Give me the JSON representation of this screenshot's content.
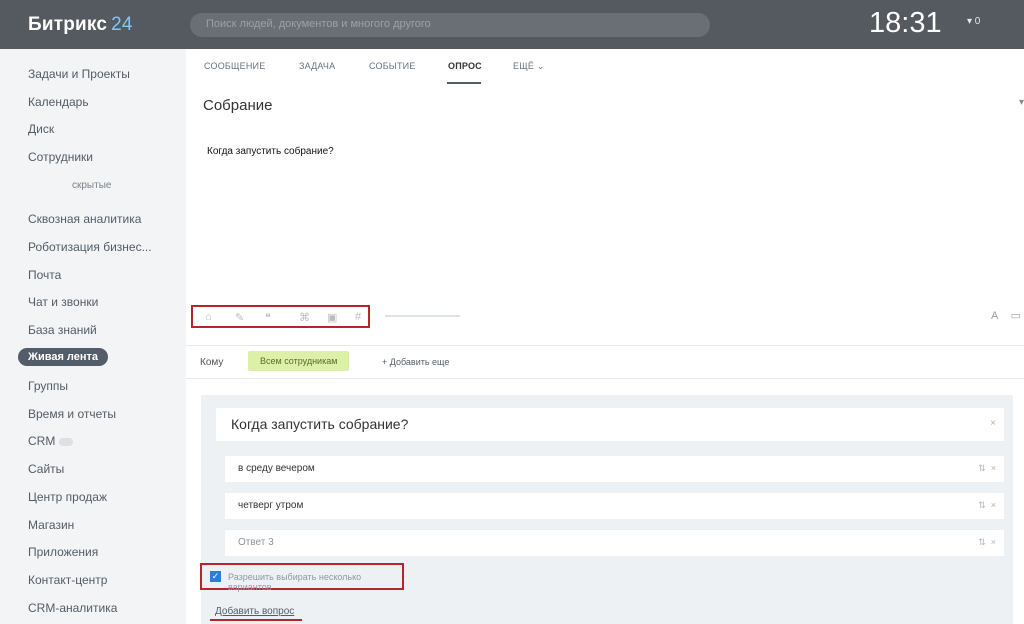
{
  "header": {
    "logo_text": "Битрикс",
    "logo_num": "24",
    "search_placeholder": "Поиск людей, документов и многого другого",
    "clock": "18:31",
    "header_control": "▾ 0"
  },
  "sidebar": {
    "items": [
      {
        "label": "Задачи и Проекты"
      },
      {
        "label": "Календарь"
      },
      {
        "label": "Диск"
      },
      {
        "label": "Сотрудники"
      }
    ],
    "sub_label": "скрытые",
    "items2": [
      {
        "label": "Сквозная аналитика"
      },
      {
        "label": "Роботизация бизнес..."
      },
      {
        "label": "Почта"
      },
      {
        "label": "Чат и звонки"
      },
      {
        "label": "База знаний"
      }
    ],
    "active_label": "Живая лента",
    "items3": [
      {
        "label": "Группы"
      },
      {
        "label": "Время и отчеты"
      },
      {
        "label": "CRM"
      },
      {
        "label": "Сайты"
      },
      {
        "label": "Центр продаж"
      },
      {
        "label": "Магазин"
      },
      {
        "label": "Приложения"
      },
      {
        "label": "Контакт-центр"
      },
      {
        "label": "CRM-аналитика"
      }
    ]
  },
  "tabs": [
    {
      "label": "Сообщение"
    },
    {
      "label": "Задача"
    },
    {
      "label": "Событие"
    },
    {
      "label": "Опрос",
      "active": true
    },
    {
      "label": "Ещё ⌄"
    }
  ],
  "post": {
    "title": "Собрание",
    "body": "Когда запустить собрание?"
  },
  "recipients": {
    "label": "Кому",
    "chip": "Всем сотрудникам",
    "add_more": "+ Добавить еще"
  },
  "poll": {
    "question": "Когда запустить собрание?",
    "answers": [
      {
        "text": "в среду вечером",
        "placeholder": false
      },
      {
        "text": "четверг утром",
        "placeholder": false
      },
      {
        "text": "Ответ  3",
        "placeholder": true
      }
    ],
    "multi_label": "Разрешить выбирать несколько вариантов",
    "add_question": "Добавить вопрос"
  },
  "colors": {
    "header_bg": "#555a61",
    "accent_blue": "#7fc8f1",
    "highlight_red": "#b5262b",
    "chip_green": "#ddf0a8"
  }
}
